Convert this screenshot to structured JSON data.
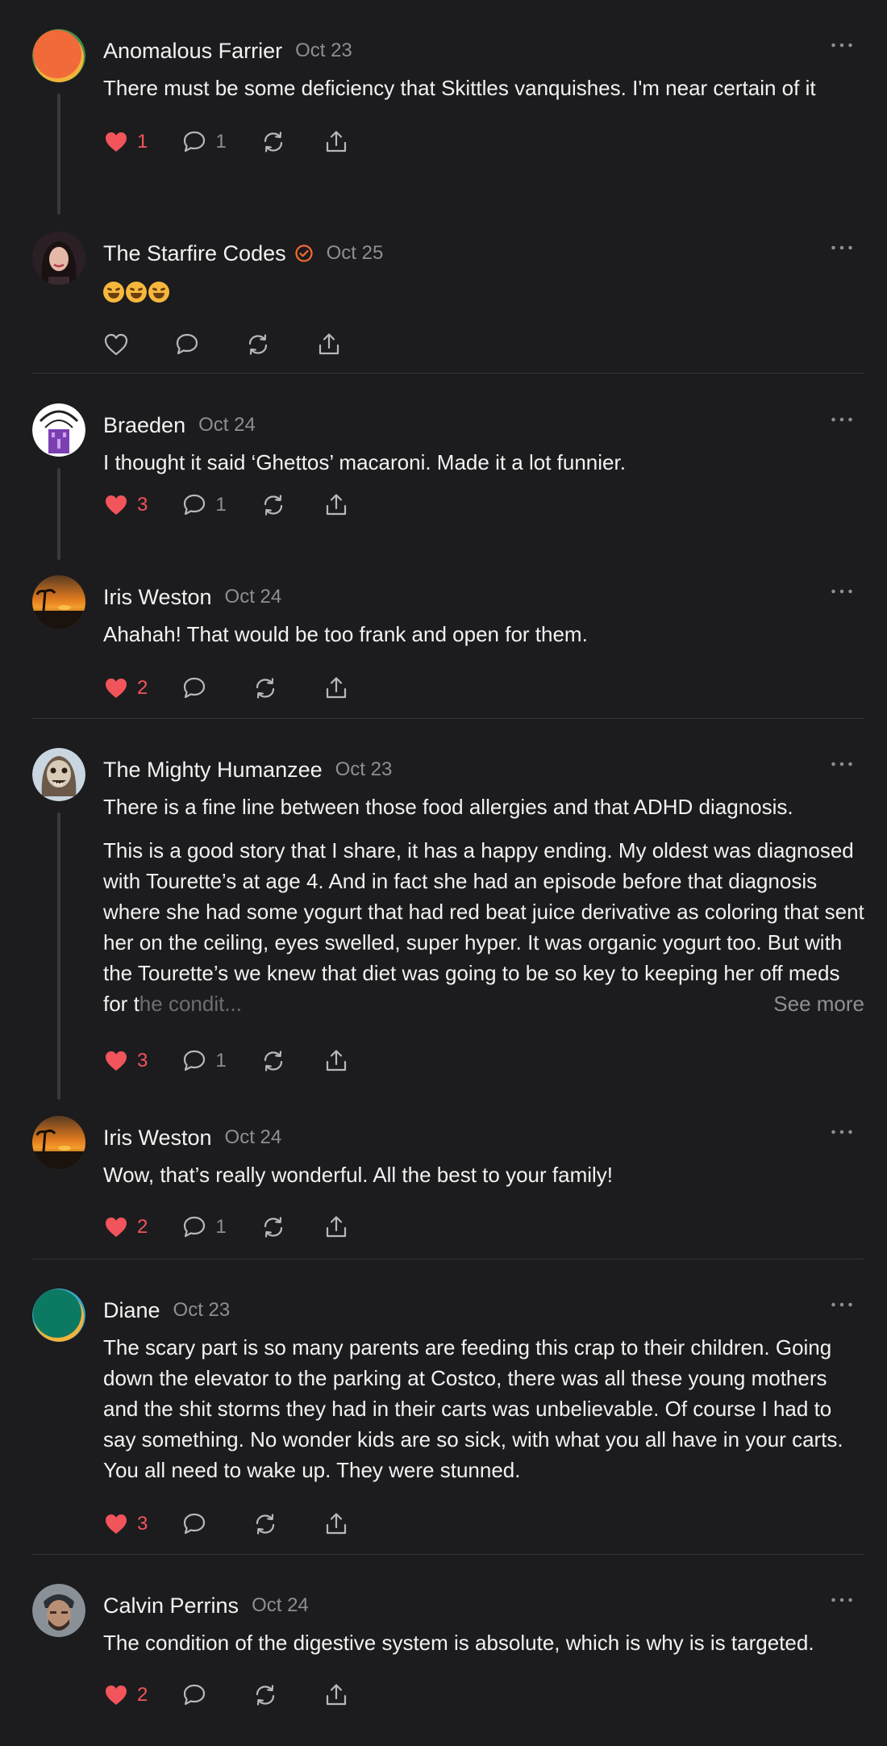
{
  "colors": {
    "background": "#1c1c1e",
    "like": "#f2545b",
    "muted": "#8e8e93",
    "verified": "#f36a2e"
  },
  "icons": {
    "like": "heart-icon",
    "reply": "comment-icon",
    "repost": "repost-icon",
    "share": "share-icon",
    "more": "more-icon",
    "verified": "verified-icon"
  },
  "posts": [
    {
      "author": "Anomalous Farrier",
      "date": "Oct 23",
      "text": "There must be some deficiency that Skittles vanquishes. I'm near certain of it",
      "likes": "1",
      "replies": "1"
    },
    {
      "author": "The Starfire Codes",
      "date": "Oct 25",
      "verified": true,
      "text": "🤣🤣🤣",
      "likes": "",
      "replies": ""
    },
    {
      "author": "Braeden",
      "date": "Oct 24",
      "text": "I thought it said ‘Ghettos’ macaroni. Made it a lot funnier.",
      "likes": "3",
      "replies": "1"
    },
    {
      "author": "Iris Weston",
      "date": "Oct 24",
      "text": "Ahahah! That would be too frank and open for them.",
      "likes": "2",
      "replies": ""
    },
    {
      "author": "The Mighty Humanzee",
      "date": "Oct 23",
      "text": "There is a fine line between those food allergies and that ADHD diagnosis.",
      "text_2": "This is a good story that I share, it has a happy ending. My oldest was diagnosed with Tourette’s at age 4. And in fact she had an episode before that diagnosis where she had some yogurt that had red beat juice derivative as coloring that sent her on the ceiling, eyes swelled, super hyper. It was organic yogurt too. But with the Tourette’s we knew that diet was going to be so key to keeping her off meds for t",
      "text_2_fade": "he condit...",
      "see_more": "See more",
      "likes": "3",
      "replies": "1"
    },
    {
      "author": "Iris Weston",
      "date": "Oct 24",
      "text": "Wow, that’s really wonderful. All the best to your family!",
      "likes": "2",
      "replies": "1"
    },
    {
      "author": "Diane",
      "date": "Oct 23",
      "text": "The scary part is so many parents are feeding this crap to their children. Going down the elevator to the parking at Costco, there was all these young mothers and the shit storms they had in their carts was unbelievable. Of course I had to say something. No wonder kids are so sick, with what you all have in your carts. You all need to wake up. They were stunned.",
      "likes": "3",
      "replies": ""
    },
    {
      "author": "Calvin Perrins",
      "date": "Oct 24",
      "text": "The condition of the digestive system is absolute, which is why is is targeted.",
      "likes": "2",
      "replies": ""
    }
  ]
}
